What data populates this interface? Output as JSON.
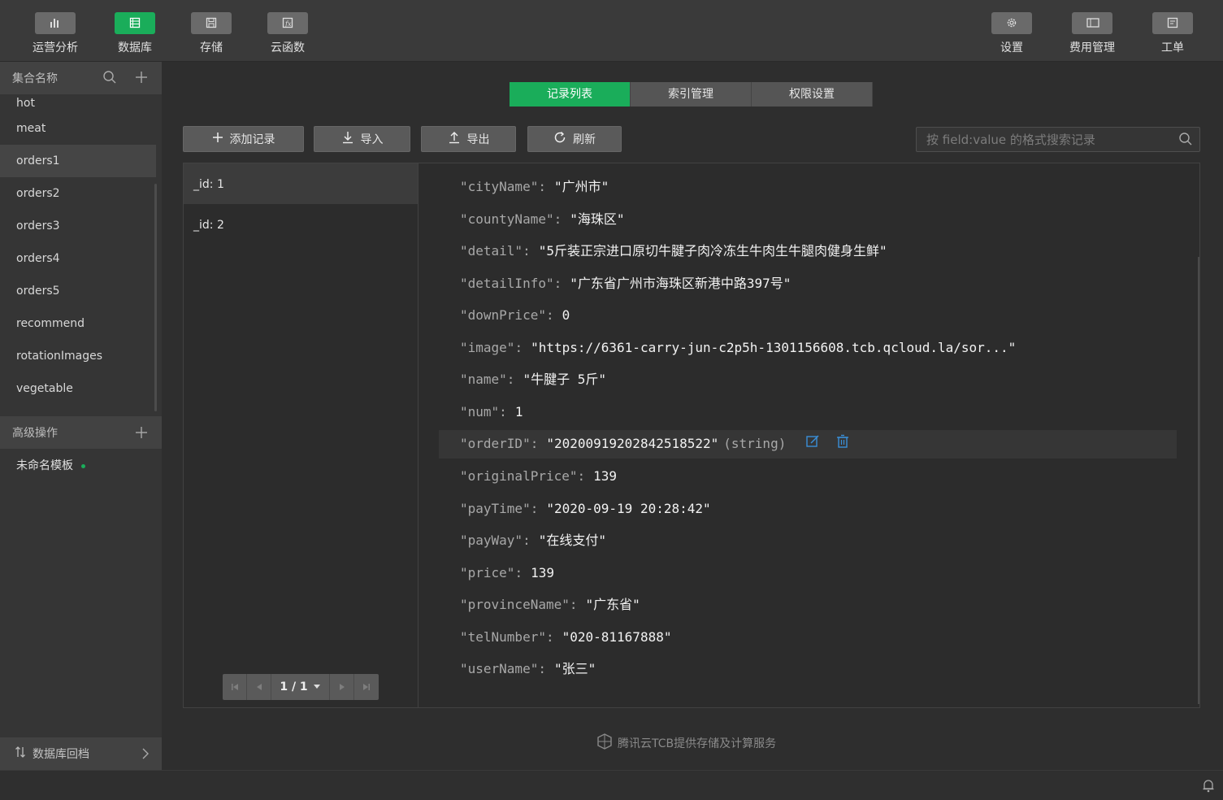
{
  "toolbar": {
    "left": [
      {
        "label": "运营分析",
        "icon": "bar-chart-icon"
      },
      {
        "label": "数据库",
        "icon": "database-icon"
      },
      {
        "label": "存储",
        "icon": "save-icon"
      },
      {
        "label": "云函数",
        "icon": "function-icon"
      }
    ],
    "right": [
      {
        "label": "设置",
        "icon": "gear-icon"
      },
      {
        "label": "费用管理",
        "icon": "billing-icon"
      },
      {
        "label": "工单",
        "icon": "ticket-icon"
      }
    ],
    "active": "数据库"
  },
  "sidebar": {
    "collections_title": "集合名称",
    "collections": [
      "hot",
      "meat",
      "orders1",
      "orders2",
      "orders3",
      "orders4",
      "orders5",
      "recommend",
      "rotationImages",
      "vegetable"
    ],
    "selected": "orders1",
    "advanced_title": "高级操作",
    "template": "未命名模板",
    "rollback": "数据库回档"
  },
  "tabs": [
    "记录列表",
    "索引管理",
    "权限设置"
  ],
  "actions": {
    "add": "添加记录",
    "import": "导入",
    "export": "导出",
    "refresh": "刷新",
    "search_placeholder": "按 field:value 的格式搜索记录"
  },
  "records": [
    "_id: 1",
    "_id: 2"
  ],
  "pager": "1 / 1",
  "document": [
    {
      "key": "\"cityName\"",
      "value": "\"广州市\""
    },
    {
      "key": "\"countyName\"",
      "value": "\"海珠区\""
    },
    {
      "key": "\"detail\"",
      "value": "\"5斤装正宗进口原切牛腱子肉冷冻生牛肉生牛腿肉健身生鲜\""
    },
    {
      "key": "\"detailInfo\"",
      "value": "\"广东省广州市海珠区新港中路397号\""
    },
    {
      "key": "\"downPrice\"",
      "value": "0"
    },
    {
      "key": "\"image\"",
      "value": "\"https://6361-carry-jun-c2p5h-1301156608.tcb.qcloud.la/sor...\""
    },
    {
      "key": "\"name\"",
      "value": "\"牛腱子 5斤\""
    },
    {
      "key": "\"num\"",
      "value": "1"
    },
    {
      "key": "\"orderID\"",
      "value": "\"20200919202842518522\"",
      "type": "(string)"
    },
    {
      "key": "\"originalPrice\"",
      "value": "139"
    },
    {
      "key": "\"payTime\"",
      "value": "\"2020-09-19 20:28:42\""
    },
    {
      "key": "\"payWay\"",
      "value": "\"在线支付\""
    },
    {
      "key": "\"price\"",
      "value": "139"
    },
    {
      "key": "\"provinceName\"",
      "value": "\"广东省\""
    },
    {
      "key": "\"telNumber\"",
      "value": "\"020-81167888\""
    },
    {
      "key": "\"userName\"",
      "value": "\"张三\""
    }
  ],
  "footer": "腾讯云TCB提供存储及计算服务",
  "colors": {
    "accent": "#1aad5a",
    "edit": "#3a8fd8"
  }
}
